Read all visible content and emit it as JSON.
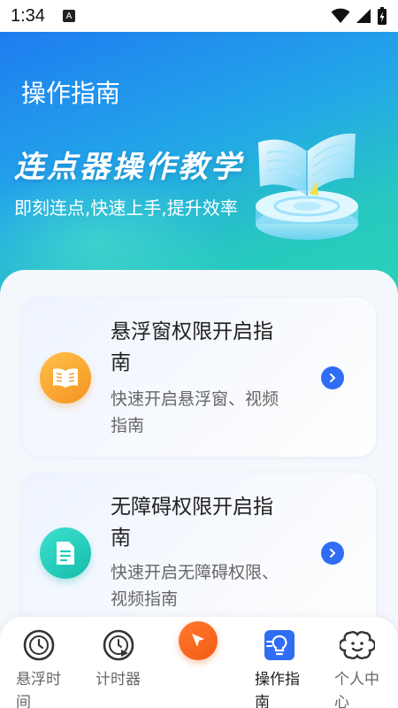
{
  "status_bar": {
    "time": "1:34",
    "notification_letter": "A"
  },
  "header": {
    "title": "操作指南"
  },
  "hero": {
    "heading": "连点器操作教学",
    "subtitle": "即刻连点,快速上手,提升效率",
    "illustration": "open-book-on-platform"
  },
  "guides": [
    {
      "title": "悬浮窗权限开启指南",
      "description": "快速开启悬浮窗、视频指南",
      "icon": "book-icon",
      "color": "#f7a02c"
    },
    {
      "title": "无障碍权限开启指南",
      "description": "快速开启无障碍权限、视频指南",
      "icon": "document-icon",
      "color": "#1fcdb9"
    }
  ],
  "tabbar": {
    "items": [
      {
        "label": "悬浮时间",
        "icon": "clock-icon",
        "active": false
      },
      {
        "label": "计时器",
        "icon": "timer-play-icon",
        "active": false
      },
      {
        "label": "",
        "icon": "cursor-click-icon",
        "active": false
      },
      {
        "label": "操作指南",
        "icon": "lightbulb-guide-icon",
        "active": true
      },
      {
        "label": "个人中心",
        "icon": "profile-face-icon",
        "active": false
      }
    ]
  },
  "colors": {
    "accent": "#2f6df5",
    "hero_start": "#1e7df0",
    "hero_end": "#2ad2b8",
    "center_button": "#f45a14"
  }
}
